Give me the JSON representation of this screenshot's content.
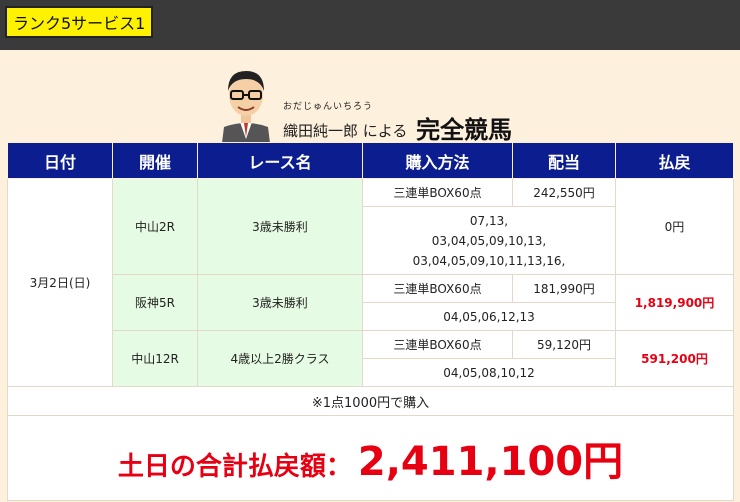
{
  "badge": {
    "label": "ランク5サービス1"
  },
  "header": {
    "furigana": "おだじゅんいちろう",
    "name": "織田純一郎",
    "connector": "による",
    "title": "完全競馬"
  },
  "table": {
    "headers": [
      "日付",
      "開催",
      "レース名",
      "購入方法",
      "配当",
      "払戻"
    ],
    "date": "3月2日(日)",
    "races": [
      {
        "venue": "中山2R",
        "race": "3歳未勝利",
        "method": "三連単BOX60点",
        "dividend": "242,550円",
        "numbers": [
          "07,13,",
          "03,04,05,09,10,13,",
          "03,04,05,09,10,11,13,16,"
        ],
        "payout": "0円"
      },
      {
        "venue": "阪神5R",
        "race": "3歳未勝利",
        "method": "三連単BOX60点",
        "dividend": "181,990円",
        "numbers": [
          "04,05,06,12,13"
        ],
        "payout": "1,819,900円"
      },
      {
        "venue": "中山12R",
        "race": "4歳以上2勝クラス",
        "method": "三連単BOX60点",
        "dividend": "59,120円",
        "numbers": [
          "04,05,08,10,12"
        ],
        "payout": "591,200円"
      }
    ],
    "note": "※1点1000円で購入",
    "total_label": "土日の合計払戻額：",
    "total_value": "2,411,100円"
  },
  "colors": {
    "header_bg": "#0c1d8f",
    "highlight": "#e60012",
    "badge": "#fff200",
    "venue_bg": "#e6fbe3"
  }
}
